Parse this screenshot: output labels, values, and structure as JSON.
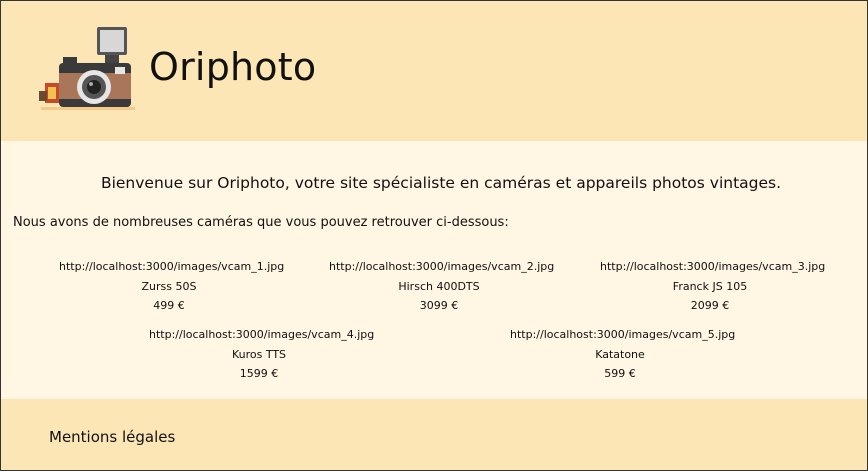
{
  "header": {
    "brand": "Oriphoto",
    "logo_icon": "vintage-camera-icon"
  },
  "main": {
    "welcome": "Bienvenue sur Oriphoto, votre site spécialiste en caméras et appareils photos vintages.",
    "intro": "Nous avons de nombreuses caméras que vous pouvez retrouver ci-dessous:",
    "products": [
      {
        "image_url": "http://localhost:3000/images/vcam_1.jpg",
        "name": "Zurss 50S",
        "price": "499 €"
      },
      {
        "image_url": "http://localhost:3000/images/vcam_2.jpg",
        "name": "Hirsch 400DTS",
        "price": "3099 €"
      },
      {
        "image_url": "http://localhost:3000/images/vcam_3.jpg",
        "name": "Franck JS 105",
        "price": "2099 €"
      },
      {
        "image_url": "http://localhost:3000/images/vcam_4.jpg",
        "name": "Kuros TTS",
        "price": "1599 €"
      },
      {
        "image_url": "http://localhost:3000/images/vcam_5.jpg",
        "name": "Katatone",
        "price": "599 €"
      }
    ]
  },
  "footer": {
    "legal_link": "Mentions légales"
  },
  "colors": {
    "header_bg": "#fde6b6",
    "content_bg": "#fff6e3",
    "footer_bg": "#fde6b6"
  }
}
